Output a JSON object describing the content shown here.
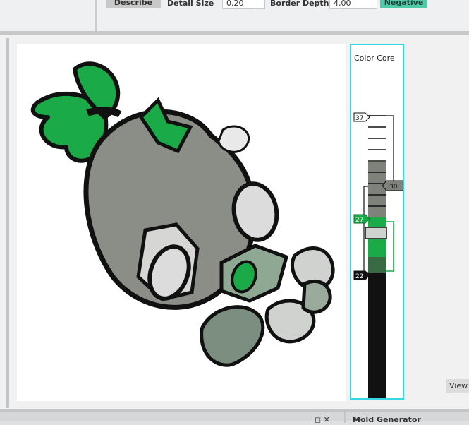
{
  "toolbar": {
    "describe_label": "Describe",
    "detail_size_label": "Detail Size",
    "detail_size_value": "0,20",
    "border_depth_label": "Border Depth",
    "border_depth_value": "4,00",
    "negative_label": "Negative"
  },
  "color_core": {
    "title": "Color Core",
    "markers": {
      "top": "37",
      "upper": "30",
      "mid": "27",
      "low": "22"
    },
    "colors": {
      "outline": "#36d6e6",
      "green": "#1aaa48",
      "gray": "#7f817b",
      "dark": "#111111"
    }
  },
  "view_button": {
    "label": "View"
  },
  "bottom_panel": {
    "title": "Mold Generator",
    "controls": "◻ ✕"
  }
}
